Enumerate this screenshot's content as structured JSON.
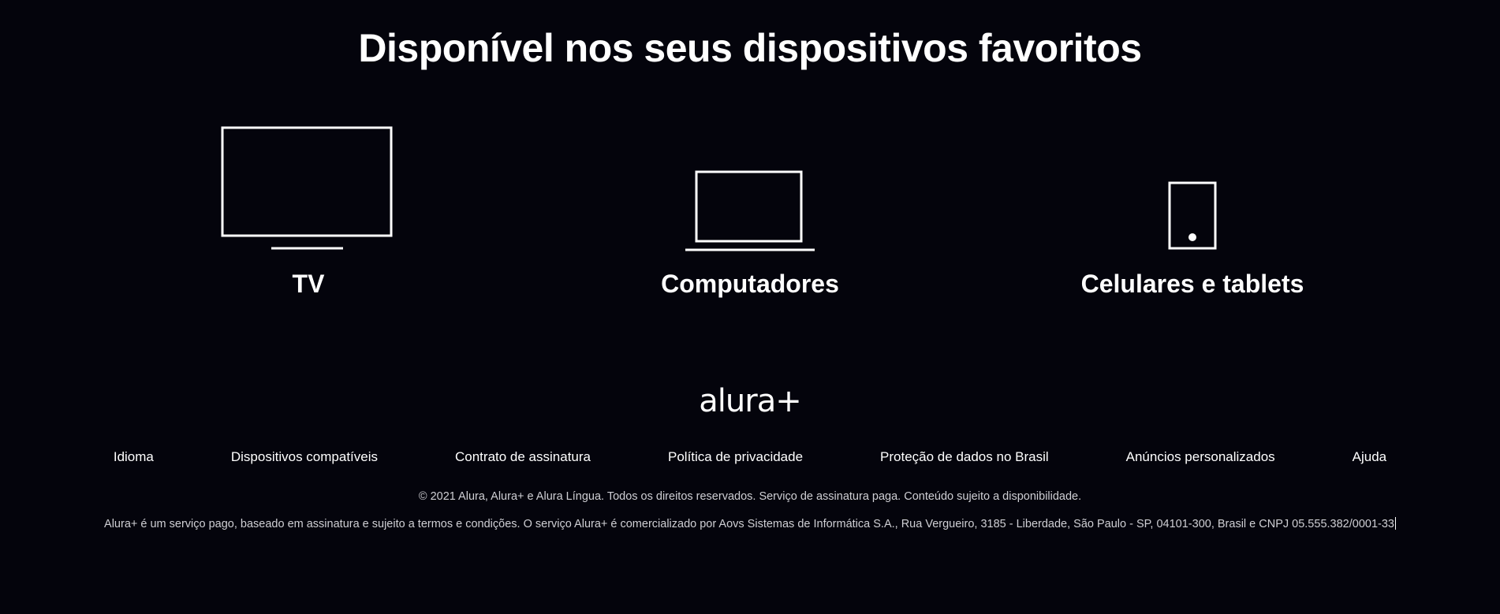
{
  "devices_section": {
    "heading": "Disponível nos seus dispositivos favoritos",
    "devices": [
      {
        "label": "TV",
        "icon": "tv-icon"
      },
      {
        "label": "Computadores",
        "icon": "laptop-icon"
      },
      {
        "label": "Celulares e tablets",
        "icon": "tablet-icon"
      }
    ]
  },
  "footer": {
    "logo": "alura+",
    "links": [
      {
        "label": "Idioma"
      },
      {
        "label": "Dispositivos compatíveis"
      },
      {
        "label": "Contrato de assinatura"
      },
      {
        "label": "Política de privacidade"
      },
      {
        "label": "Proteção de dados no Brasil"
      },
      {
        "label": "Anúncios personalizados"
      },
      {
        "label": "Ajuda"
      }
    ],
    "copyright": "© 2021 Alura, Alura+ e Alura Língua. Todos os direitos reservados. Serviço de assinatura paga. Conteúdo sujeito a disponibilidade.",
    "legal": "Alura+ é um serviço pago, baseado em assinatura e sujeito a termos e condições. O serviço Alura+ é comercializado por Aovs Sistemas de Informática S.A., Rua Vergueiro, 3185 - Liberdade, São Paulo - SP, 04101-300, Brasil e CNPJ 05.555.382/0001-33"
  },
  "colors": {
    "background": "#04040c",
    "text": "#ffffff",
    "muted_text": "#cfcfd4"
  }
}
